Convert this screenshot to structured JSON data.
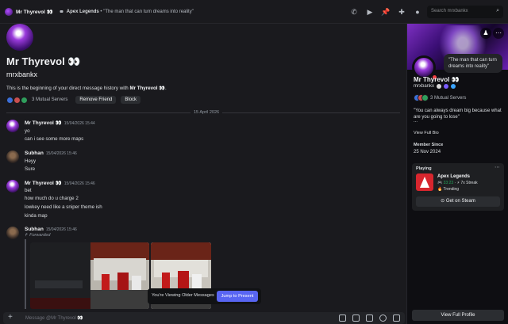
{
  "topbar": {
    "name": "Mr Thyrevol",
    "emoji": "👀",
    "game": "Apex Legends",
    "quote": "\"The man that can turn dreams into reality\"",
    "search_placeholder": "Search mrxbankx"
  },
  "intro": {
    "display_name": "Mr Thyrevol 👀",
    "username": "mrxbankx",
    "text_prefix": "This is the beginning of your direct message history with ",
    "text_name": "Mr Thyrevol 👀",
    "text_suffix": ".",
    "mutual_servers": "3 Mutual Servers",
    "remove_friend": "Remove Friend",
    "block": "Block"
  },
  "date_divider": "15 April 2026",
  "messages": [
    {
      "author": "Mr Thyrevol 👀",
      "time": "15/04/2026 15:44",
      "lines": [
        "yo",
        "can i see some more maps"
      ]
    },
    {
      "author": "Subhan",
      "time": "15/04/2026 15:46",
      "lines": [
        "Heyy",
        "Sure"
      ]
    },
    {
      "author": "Mr Thyrevol 👀",
      "time": "15/04/2026 15:46",
      "lines": [
        "bet",
        "how much do u charge 2",
        "lowkey need like a sniper theme ish",
        "kinda map"
      ]
    },
    {
      "author": "Subhan",
      "time": "15/04/2026 15:46",
      "lines": []
    }
  ],
  "forwarded_label": "Forwarded",
  "older_banner": {
    "text": "You're Viewing Older Messages",
    "jump": "Jump to Present"
  },
  "composer": {
    "placeholder": "Message @Mr Thyrevol 👀"
  },
  "profile": {
    "bubble": "\"The man that can turn dreams into reality\"",
    "name": "Mr Thyrevol 👀",
    "username": "mrxbankx",
    "mutual": "3 Mutual Servers",
    "bio": "\"You can always dream big because what are you going to lose\"",
    "bio_more": "...",
    "view_full_bio": "View Full Bio",
    "member_since_label": "Member Since",
    "member_since": "25 Nov 2024",
    "playing_label": "Playing",
    "game": "Apex Legends",
    "play_time": "33:23",
    "streak": "7x Streak",
    "trending": "Trending",
    "steam_button": "Get on Steam",
    "full_profile_button": "View Full Profile"
  },
  "colors": {
    "accent": "#5865f2",
    "dnd": "#f23f43",
    "online_time": "#23a55a",
    "apex": "#d7262e"
  }
}
